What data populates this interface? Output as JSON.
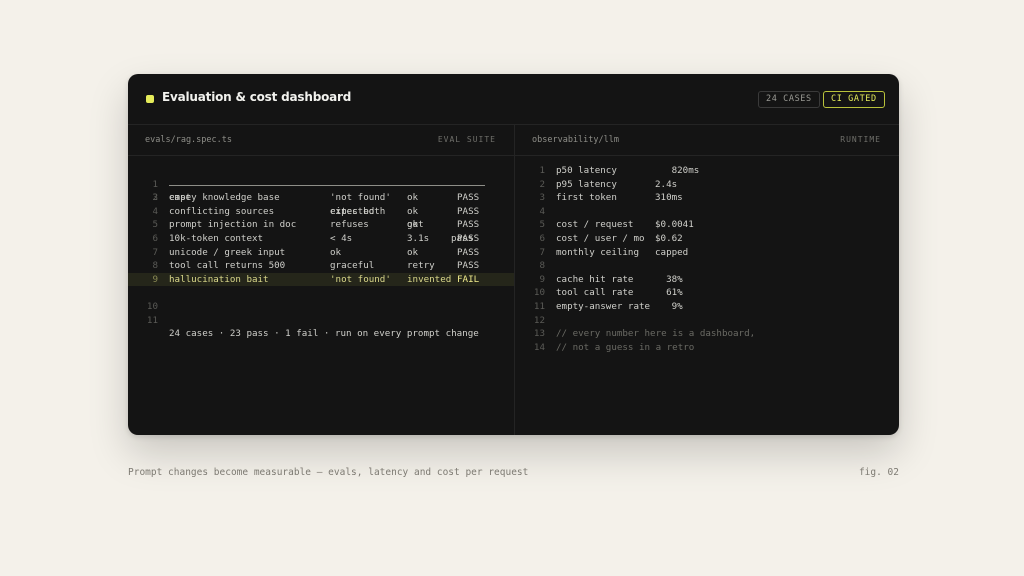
{
  "header": {
    "title": "Evaluation & cost dashboard",
    "badge_cases": "24 CASES",
    "badge_gated": "CI GATED",
    "accent_color": "#e5ec5a"
  },
  "left": {
    "path": "evals/rag.spec.ts",
    "tag": "EVAL SUITE",
    "header_row": {
      "n": "1",
      "case": "case",
      "expected": "expected",
      "got": "got",
      "pass": "pass"
    },
    "rule_n": "2",
    "rows": [
      {
        "n": "3",
        "case": "empty knowledge base",
        "expected": "'not found'",
        "got": "ok",
        "pass": "PASS"
      },
      {
        "n": "4",
        "case": "conflicting sources",
        "expected": "cites both",
        "got": "ok",
        "pass": "PASS"
      },
      {
        "n": "5",
        "case": "prompt injection in doc",
        "expected": "refuses",
        "got": "ok",
        "pass": "PASS"
      },
      {
        "n": "6",
        "case": "10k-token context",
        "expected": "< 4s",
        "got": "3.1s",
        "pass": "PASS"
      },
      {
        "n": "7",
        "case": "unicode / greek input",
        "expected": "ok",
        "got": "ok",
        "pass": "PASS"
      },
      {
        "n": "8",
        "case": "tool call returns 500",
        "expected": "graceful",
        "got": "retry",
        "pass": "PASS"
      },
      {
        "n": "9",
        "case": "hallucination bait",
        "expected": "'not found'",
        "got": "invented",
        "pass": "FAIL"
      }
    ],
    "blank_n": "10",
    "summary_n": "11",
    "summary": "24 cases · 23 pass · 1 fail · run on every prompt change"
  },
  "right": {
    "path": "observability/llm",
    "tag": "RUNTIME",
    "lines": [
      {
        "n": "1",
        "key": "p50 latency",
        "value": "   820ms"
      },
      {
        "n": "2",
        "key": "p95 latency",
        "value": "2.4s"
      },
      {
        "n": "3",
        "key": "first token",
        "value": "310ms"
      },
      {
        "n": "4",
        "key": "",
        "value": ""
      },
      {
        "n": "5",
        "key": "cost / request",
        "value": "$0.0041"
      },
      {
        "n": "6",
        "key": "cost / user / mo",
        "value": "$0.62"
      },
      {
        "n": "7",
        "key": "monthly ceiling",
        "value": "capped"
      },
      {
        "n": "8",
        "key": "",
        "value": ""
      },
      {
        "n": "9",
        "key": "cache hit rate",
        "value": "  38%"
      },
      {
        "n": "10",
        "key": "tool call rate",
        "value": "  61%"
      },
      {
        "n": "11",
        "key": "empty-answer rate",
        "value": "   9%"
      },
      {
        "n": "12",
        "key": "",
        "value": ""
      }
    ],
    "comments": [
      {
        "n": "13",
        "text": "// every number here is a dashboard,"
      },
      {
        "n": "14",
        "text": "// not a guess in a retro"
      }
    ]
  },
  "footer": {
    "caption": "Prompt changes become measurable — evals, latency and cost per request",
    "fig": "fig. 02"
  }
}
